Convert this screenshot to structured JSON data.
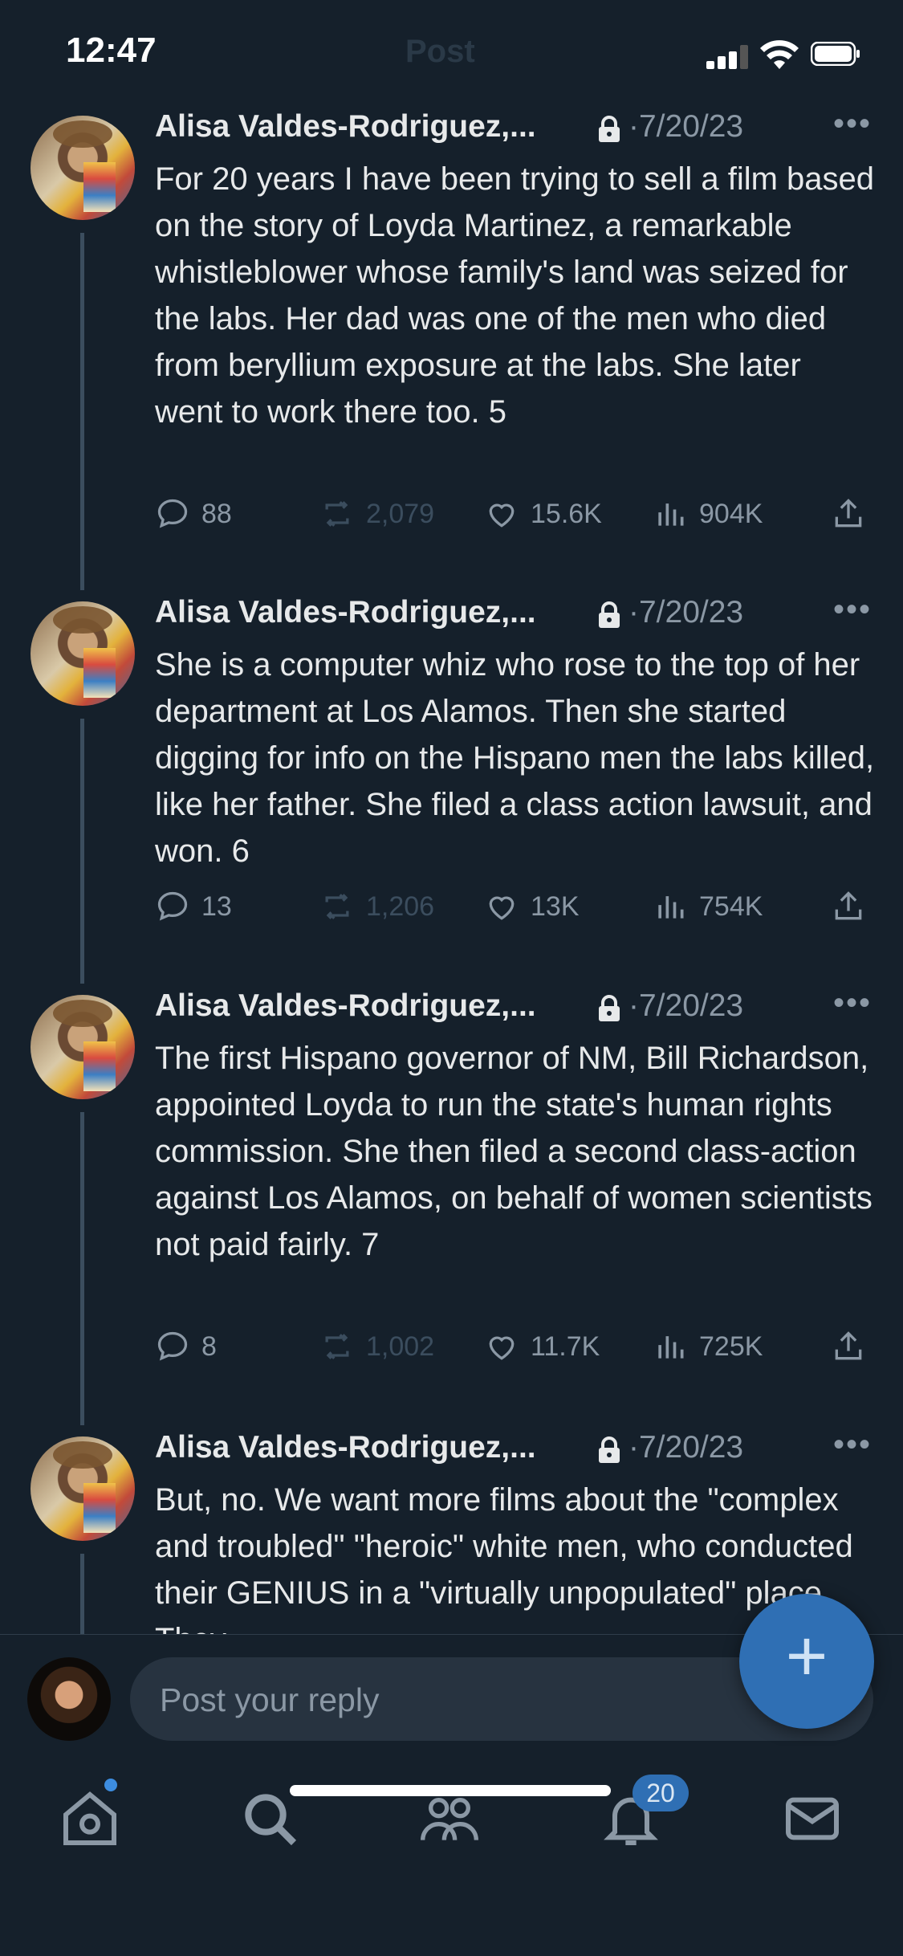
{
  "status_bar": {
    "time": "12:47",
    "ghost_title": "Post"
  },
  "tweets": [
    {
      "author": "Alisa Valdes-Rodriguez,...",
      "date": "·7/20/23",
      "text": "For 20 years I have been trying to sell a film based on the story of Loyda Martinez, a remarkable whistleblower whose family's land was seized for the labs. Her dad was one of the men who died from beryllium exposure at the labs. She later went to work there too. 5",
      "replies": "88",
      "reposts": "2,079",
      "likes": "15.6K",
      "views": "904K"
    },
    {
      "author": "Alisa Valdes-Rodriguez,...",
      "date": "·7/20/23",
      "text": "She is a computer whiz who rose to the top of her department at Los Alamos. Then she started digging for info on the Hispano men the labs killed, like her father. She filed a class action lawsuit, and won. 6",
      "replies": "13",
      "reposts": "1,206",
      "likes": "13K",
      "views": "754K"
    },
    {
      "author": "Alisa Valdes-Rodriguez,...",
      "date": "·7/20/23",
      "text": "The first Hispano governor of NM, Bill Richardson, appointed Loyda to run the state's human rights commission. She then filed a second class-action against Los Alamos, on behalf of women scientists not paid fairly. 7",
      "replies": "8",
      "reposts": "1,002",
      "likes": "11.7K",
      "views": "725K"
    },
    {
      "author": "Alisa Valdes-Rodriguez,...",
      "date": "·7/20/23",
      "text": "But, no. We want more films about the \"complex and troubled\" \"heroic\" white men, who conducted their GENIUS in a \"virtually unpopulated\" place. They..."
    }
  ],
  "reply": {
    "placeholder": "Post your reply"
  },
  "fab_label": "+",
  "nav": {
    "notifications_count": "20"
  },
  "colors": {
    "background": "#15202b",
    "accent": "#1d9bf0",
    "muted": "#8b98a5"
  }
}
